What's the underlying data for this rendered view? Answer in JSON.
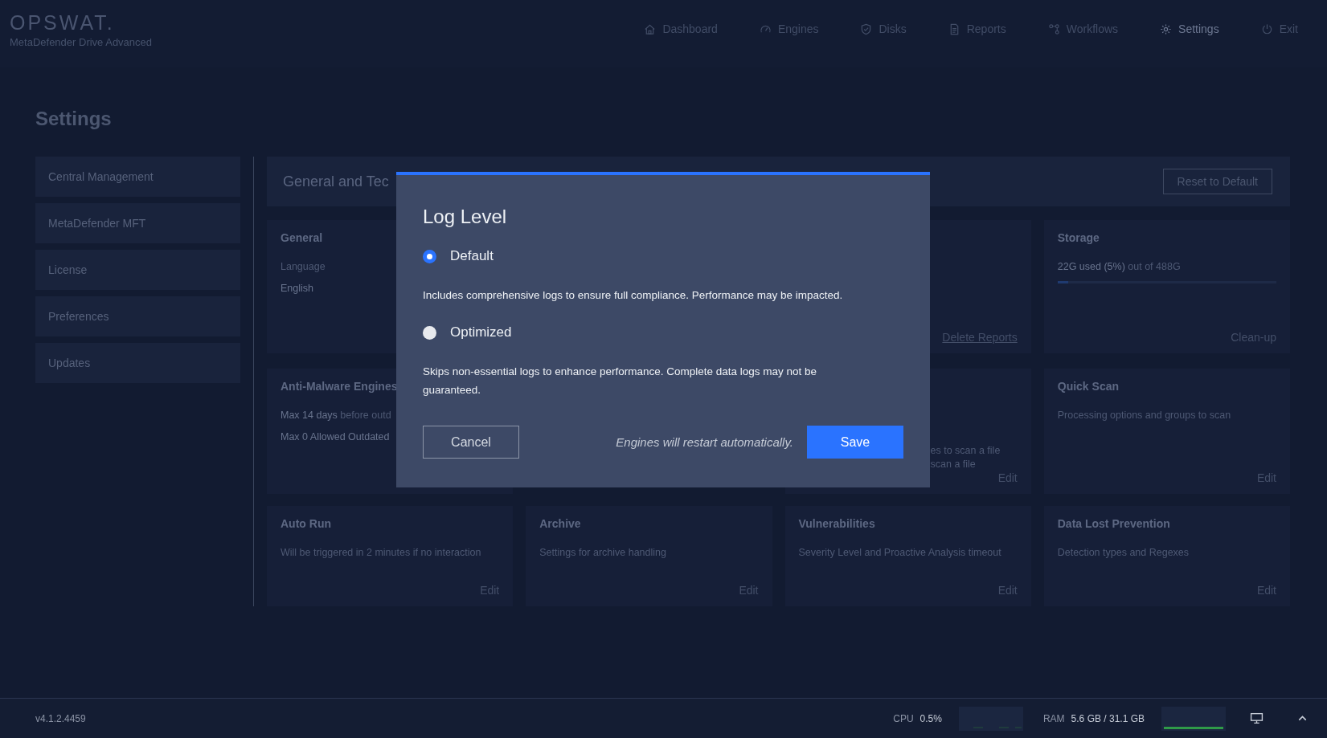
{
  "header": {
    "logo": "OPSWAT.",
    "subtitle": "MetaDefender Drive Advanced",
    "nav": [
      {
        "label": "Dashboard",
        "selected": false
      },
      {
        "label": "Engines",
        "selected": false
      },
      {
        "label": "Disks",
        "selected": false
      },
      {
        "label": "Reports",
        "selected": false
      },
      {
        "label": "Workflows",
        "selected": false
      },
      {
        "label": "Settings",
        "selected": true
      },
      {
        "label": "Exit",
        "selected": false
      }
    ]
  },
  "page_title": "Settings",
  "sidebar": {
    "items": [
      {
        "label": "Central Management"
      },
      {
        "label": "MetaDefender MFT"
      },
      {
        "label": "License"
      },
      {
        "label": "Preferences"
      },
      {
        "label": "Updates"
      }
    ]
  },
  "section": {
    "title": "General and Tec",
    "reset_button": "Reset to Default"
  },
  "card_rows": [
    {
      "cards": [
        {
          "kind": "full",
          "title": "General",
          "lines": [
            [
              {
                "text": "Language",
                "dim": true
              }
            ],
            [
              {
                "text": "English",
                "dim": false
              }
            ]
          ]
        },
        {
          "kind": "covered",
          "action": {
            "label": "Delete Reports",
            "kind": "link"
          }
        },
        {
          "kind": "full",
          "title": "Storage",
          "lines": [
            [
              {
                "text": "22G used (5%)",
                "dim": false
              },
              {
                "text": " out of 488G",
                "dim": true
              }
            ]
          ],
          "level": 0.05,
          "action": {
            "label": "Clean-up",
            "kind": "plain"
          }
        }
      ]
    },
    {
      "cards": [
        {
          "kind": "full",
          "title": "Anti-Malware Engines",
          "lines": [
            [
              {
                "text": "Max 14 days",
                "dim": false
              },
              {
                "text": " before outd",
                "dim": true
              }
            ],
            [
              {
                "text": "Max 0 Allowed Outdated",
                "dim": false
              }
            ]
          ]
        },
        {
          "kind": "covered",
          "lines": [
            [
              {
                "text": "es to scan a file",
                "dim": true
              }
            ],
            [
              {
                "text": "scan a file",
                "dim": true
              }
            ]
          ],
          "action": {
            "label": "Edit",
            "kind": "plain"
          }
        },
        {
          "kind": "full",
          "title": "Quick Scan",
          "lines": [
            [
              {
                "text": "Processing options and groups to scan",
                "dim": true
              }
            ]
          ],
          "action": {
            "label": "Edit",
            "kind": "plain"
          }
        }
      ]
    },
    {
      "cards": [
        {
          "kind": "full",
          "title": "Auto Run",
          "lines": [
            [
              {
                "text": "Will be triggered in 2 minutes if no interaction",
                "dim": true
              }
            ]
          ],
          "action": {
            "label": "Edit",
            "kind": "plain"
          }
        },
        {
          "kind": "full",
          "title": "Archive",
          "lines": [
            [
              {
                "text": "Settings for archive handling",
                "dim": true
              }
            ]
          ],
          "action": {
            "label": "Edit",
            "kind": "plain"
          }
        },
        {
          "kind": "full",
          "title": "Vulnerabilities",
          "lines": [
            [
              {
                "text": "Severity Level and Proactive Analysis timeout",
                "dim": true
              }
            ]
          ],
          "action": {
            "label": "Edit",
            "kind": "plain"
          }
        },
        {
          "kind": "full",
          "title": "Data Lost Prevention",
          "lines": [
            [
              {
                "text": "Detection types and Regexes",
                "dim": true
              }
            ]
          ],
          "action": {
            "label": "Edit",
            "kind": "plain"
          }
        }
      ]
    }
  ],
  "dialog": {
    "title": "Log Level",
    "options": [
      {
        "label": "Default",
        "selected": true,
        "description": "Includes comprehensive logs to ensure full compliance. Performance may be impacted."
      },
      {
        "label": "Optimized",
        "selected": false,
        "description": "Skips non-essential logs to enhance performance. Complete data logs may not be guaranteed."
      }
    ],
    "cancel": "Cancel",
    "note": "Engines will restart automatically.",
    "save": "Save"
  },
  "status_bar": {
    "version": "v4.1.2.4459",
    "cpu_label": "CPU",
    "cpu_value": "0.5%",
    "ram_label": "RAM",
    "ram_value": "5.6 GB / 31.1 GB"
  }
}
